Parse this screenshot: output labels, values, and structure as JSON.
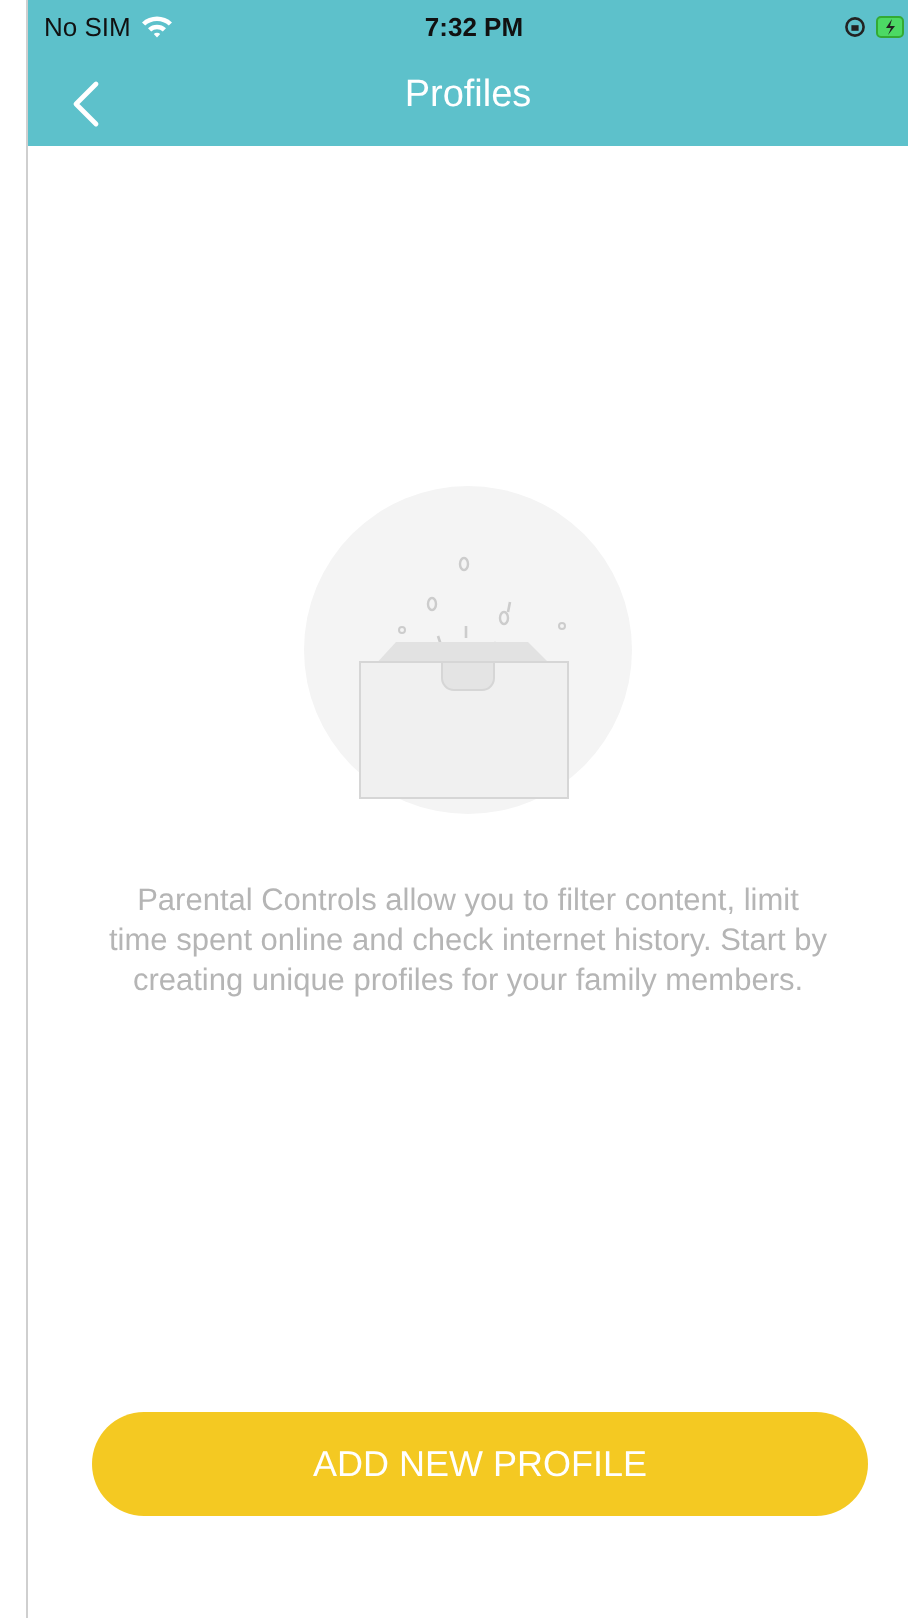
{
  "status_bar": {
    "carrier": "No SIM",
    "time": "7:32 PM"
  },
  "nav_bar": {
    "title": "Profiles"
  },
  "empty_state": {
    "message": "Parental Controls allow you to filter content, limit time spent online and check internet history. Start by creating unique profiles for your family members."
  },
  "buttons": [
    "ADD NEW PROFILE"
  ]
}
